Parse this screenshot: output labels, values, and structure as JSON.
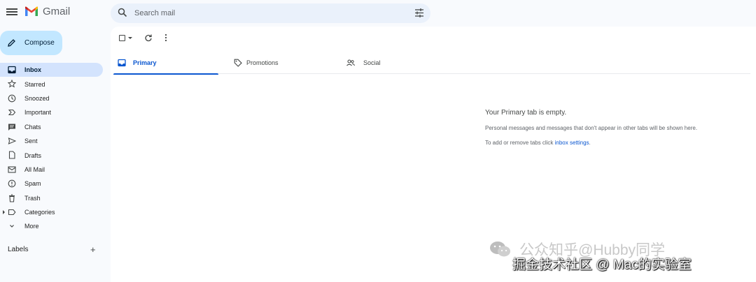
{
  "header": {
    "app_name": "Gmail",
    "search_placeholder": "Search mail"
  },
  "sidebar": {
    "compose_label": "Compose",
    "items": [
      {
        "label": "Inbox",
        "icon": "inbox-icon",
        "active": true
      },
      {
        "label": "Starred",
        "icon": "star-icon"
      },
      {
        "label": "Snoozed",
        "icon": "clock-icon"
      },
      {
        "label": "Important",
        "icon": "important-icon"
      },
      {
        "label": "Chats",
        "icon": "chat-icon"
      },
      {
        "label": "Sent",
        "icon": "send-icon"
      },
      {
        "label": "Drafts",
        "icon": "draft-icon"
      },
      {
        "label": "All Mail",
        "icon": "all-mail-icon"
      },
      {
        "label": "Spam",
        "icon": "spam-icon"
      },
      {
        "label": "Trash",
        "icon": "trash-icon"
      },
      {
        "label": "Categories",
        "icon": "label-icon"
      },
      {
        "label": "More",
        "icon": "chevron-down-icon"
      }
    ],
    "labels_heading": "Labels",
    "labels_add": "+"
  },
  "tabs": [
    {
      "label": "Primary",
      "icon": "inbox-icon",
      "active": true
    },
    {
      "label": "Promotions",
      "icon": "tag-icon"
    },
    {
      "label": "Social",
      "icon": "people-icon"
    }
  ],
  "empty_state": {
    "title": "Your Primary tab is empty.",
    "description": "Personal messages and messages that don't appear in other tabs will be shown here.",
    "settings_prefix": "To add or remove tabs click ",
    "settings_link": "inbox settings",
    "settings_suffix": "."
  },
  "watermark": {
    "line1": "公众知乎@Hubby同学",
    "line2": "掘金技术社区 @ Mac的实验室"
  },
  "colors": {
    "accent": "#0b57d0",
    "compose_bg": "#c2e7ff",
    "active_nav_bg": "#d3e3fd",
    "search_bg": "#eaf1fb"
  }
}
